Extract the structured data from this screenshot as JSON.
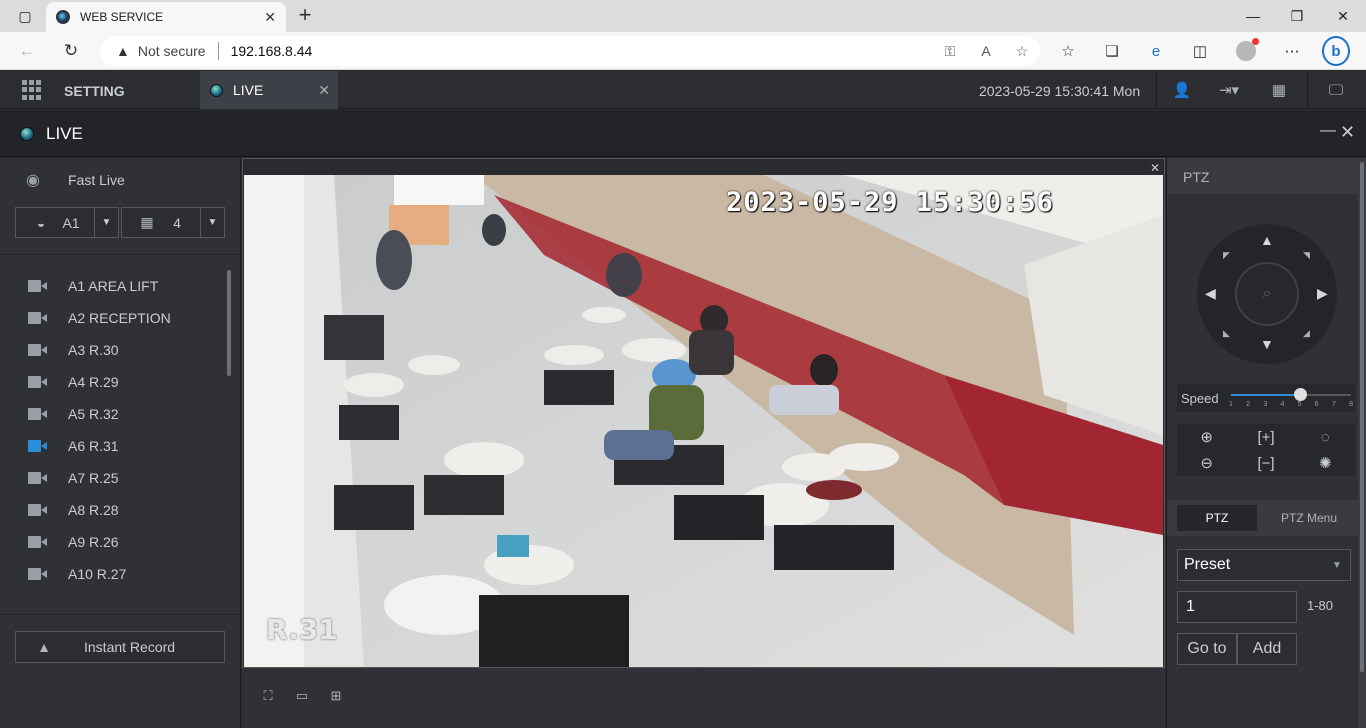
{
  "browser": {
    "tab_title": "WEB SERVICE",
    "tab_close": "✕",
    "new_tab": "+",
    "not_secure": "Not secure",
    "url": "192.168.8.44"
  },
  "header": {
    "setting_label": "SETTING",
    "live_tab_label": "LIVE",
    "datetime": "2023-05-29 15:30:41 Mon"
  },
  "live_bar": {
    "title": "LIVE"
  },
  "left": {
    "fast_live": "Fast Live",
    "area_select": "A1",
    "layout_select": "4",
    "cameras": [
      {
        "name": "A1 AREA LIFT",
        "active": false
      },
      {
        "name": "A2 RECEPTION",
        "active": false
      },
      {
        "name": "A3 R.30",
        "active": false
      },
      {
        "name": "A4 R.29",
        "active": false
      },
      {
        "name": "A5 R.32",
        "active": false
      },
      {
        "name": "A6 R.31",
        "active": true
      },
      {
        "name": "A7 R.25",
        "active": false
      },
      {
        "name": "A8 R.28",
        "active": false
      },
      {
        "name": "A9 R.26",
        "active": false
      },
      {
        "name": "A10 R.27",
        "active": false
      }
    ],
    "instant_record": "Instant Record"
  },
  "video": {
    "osd_time": "2023-05-29 15:30:56",
    "osd_name": "R.31"
  },
  "ptz": {
    "header": "PTZ",
    "speed_label": "Speed",
    "speed_value": 5,
    "speed_max": 8,
    "speed_ticks": [
      "1",
      "2",
      "3",
      "4",
      "5",
      "6",
      "7",
      "8"
    ],
    "tab_ptz": "PTZ",
    "tab_menu": "PTZ Menu",
    "preset_value": "Preset",
    "preset_number": "1",
    "range": "1-80",
    "goto_label": "Go to",
    "add_label": "Add"
  },
  "colors": {
    "accent": "#2b8ddc",
    "background": "#2b2d31",
    "panel": "#2f3136"
  }
}
